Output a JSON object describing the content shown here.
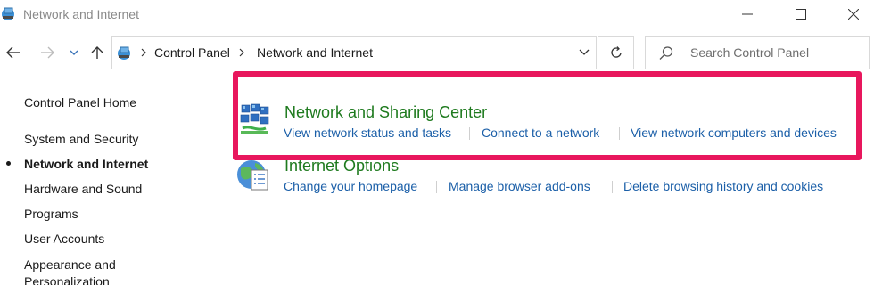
{
  "window": {
    "title": "Network and Internet"
  },
  "nav": {
    "breadcrumbs": [
      "Control Panel",
      "Network and Internet"
    ],
    "search_placeholder": "Search Control Panel"
  },
  "sidebar": {
    "home": "Control Panel Home",
    "items": [
      {
        "label": "System and Security",
        "active": false
      },
      {
        "label": "Network and Internet",
        "active": true
      },
      {
        "label": "Hardware and Sound",
        "active": false
      },
      {
        "label": "Programs",
        "active": false
      },
      {
        "label": "User Accounts",
        "active": false
      },
      {
        "label": "Appearance and Personalization",
        "active": false
      }
    ]
  },
  "categories": [
    {
      "title": "Network and Sharing Center",
      "links": [
        "View network status and tasks",
        "Connect to a network",
        "View network computers and devices"
      ],
      "highlighted": true
    },
    {
      "title": "Internet Options",
      "links": [
        "Change your homepage",
        "Manage browser add-ons",
        "Delete browsing history and cookies"
      ],
      "highlighted": false
    }
  ],
  "colors": {
    "highlight": "#e8175d",
    "category_title": "#1e7a1e",
    "link": "#1b5fa8"
  },
  "icons": [
    "network-globe-icon",
    "minimize-icon",
    "maximize-icon",
    "close-icon",
    "back-arrow-icon",
    "forward-arrow-icon",
    "chevron-down-icon",
    "up-arrow-icon",
    "chevron-right-icon",
    "refresh-icon",
    "search-icon",
    "network-sharing-icon",
    "internet-options-icon"
  ]
}
